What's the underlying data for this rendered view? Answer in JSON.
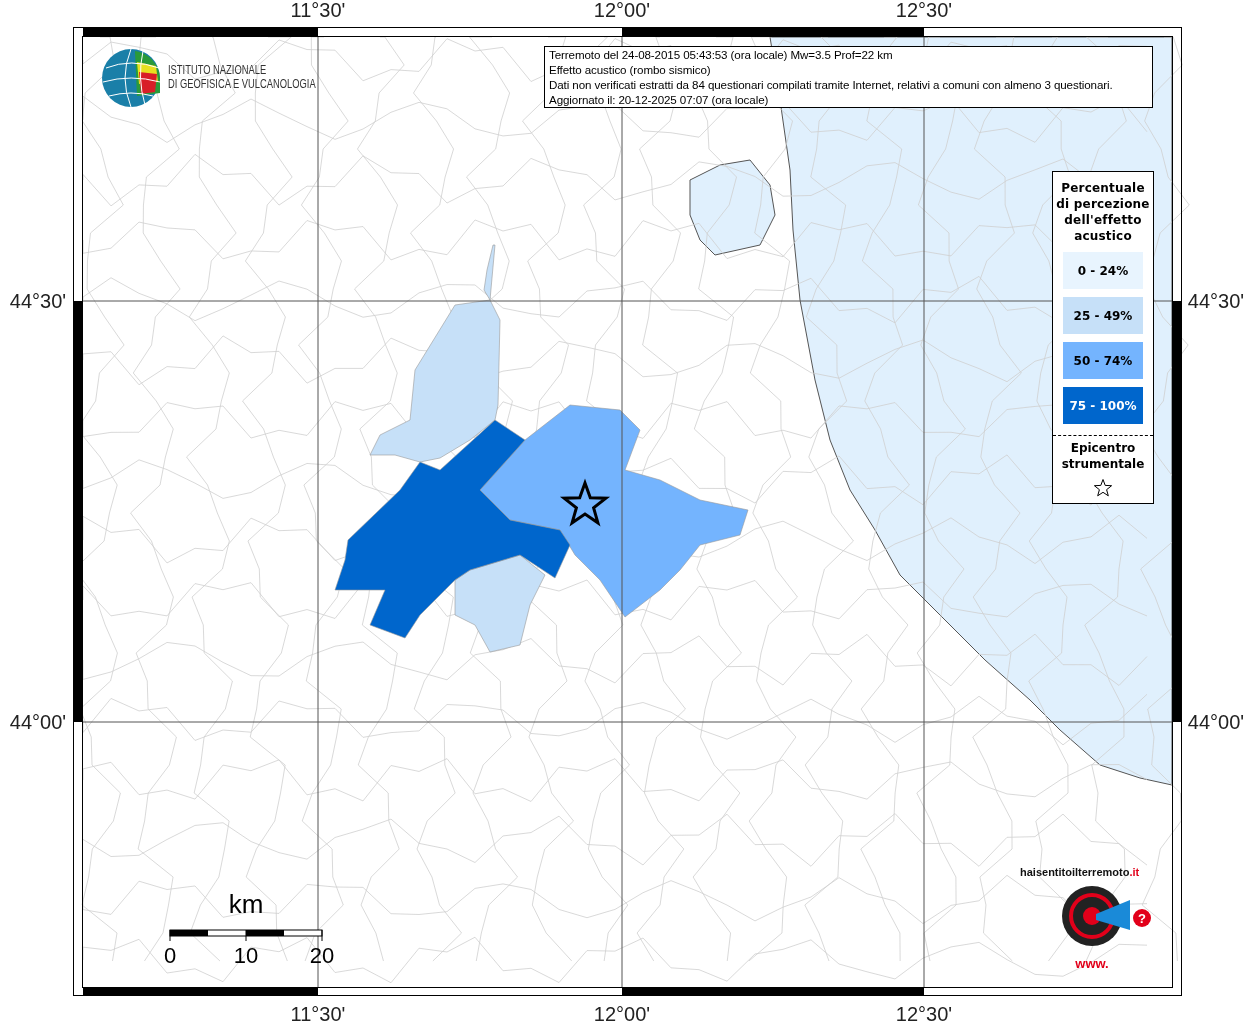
{
  "map": {
    "axis_labels": {
      "top": [
        "11°30'",
        "12°00'",
        "12°30'"
      ],
      "bottom": [
        "11°30'",
        "12°00'",
        "12°30'"
      ],
      "left": [
        "44°30'",
        "44°00'"
      ],
      "right": [
        "44°30'",
        "44°00'"
      ]
    },
    "institute_logo": {
      "lines": [
        "ISTITUTO NAZIONALE",
        "DI GEOFISICA E VULCANOLOGIA"
      ]
    },
    "info_box": {
      "lines": [
        "Terremoto del 24-08-2015 05:43:53 (ora locale) Mw=3.5 Prof=22 km",
        "Effetto acustico (rombo sismico)",
        "Dati non verificati estratti da 84 questionari compilati tramite Internet, relativi a comuni con almeno 3 questionari.",
        "Aggiornato il: 20-12-2025 07:07 (ora locale)"
      ]
    },
    "legend": {
      "title": "Percentuale di percezione dell'effetto acustico",
      "classes": [
        {
          "label": "0 - 24%",
          "color": "#e8f4fe"
        },
        {
          "label": "25 - 49%",
          "color": "#c6e0f8"
        },
        {
          "label": "50 - 74%",
          "color": "#74b4fe"
        },
        {
          "label": "75 - 100%",
          "color": "#0066cc"
        }
      ],
      "epicenter_label": "Epicentro strumentale"
    },
    "areas": [
      {
        "color": "#c6e0f8"
      },
      {
        "color": "#c6e0f8"
      },
      {
        "color": "#74b4fe"
      },
      {
        "color": "#0066cc"
      }
    ],
    "scale_bar": {
      "unit": "km",
      "ticks": [
        "0",
        "10",
        "20"
      ]
    },
    "site_logo": {
      "prefix": "www.",
      "name": "haisentitoilterremoto",
      "suffix": ".it",
      "badge": "?"
    }
  }
}
